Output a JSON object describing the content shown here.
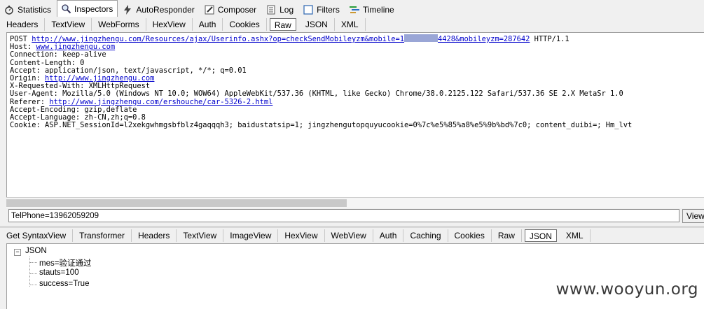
{
  "top_tabs": [
    {
      "label": "Statistics",
      "icon": "stopwatch-icon"
    },
    {
      "label": "Inspectors",
      "icon": "magnifier-icon",
      "active": true
    },
    {
      "label": "AutoResponder",
      "icon": "lightning-icon"
    },
    {
      "label": "Composer",
      "icon": "pencil-icon"
    },
    {
      "label": "Log",
      "icon": "log-icon"
    },
    {
      "label": "Filters",
      "icon": "checkbox-icon"
    },
    {
      "label": "Timeline",
      "icon": "timeline-icon"
    }
  ],
  "request_tabs": [
    "Headers",
    "TextView",
    "WebForms",
    "HexView",
    "Auth",
    "Cookies",
    "Raw",
    "JSON",
    "XML"
  ],
  "request_active": "Raw",
  "raw": {
    "method": "POST ",
    "url_pre": "http://www.jingzhengu.com/Resources/ajax/Userinfo.ashx?op=checkSendMobileyzm&mobile=1",
    "url_post": "4428&mobileyzm=287642",
    "protocol": " HTTP/1.1",
    "host_label": "Host: ",
    "host": "www.jingzhengu.com",
    "connection": "Connection: keep-alive",
    "content_length": "Content-Length: 0",
    "accept": "Accept: application/json, text/javascript, */*; q=0.01",
    "origin_label": "Origin: ",
    "origin": "http://www.jingzhengu.com",
    "x_requested": "X-Requested-With: XMLHttpRequest",
    "user_agent": "User-Agent: Mozilla/5.0 (Windows NT 10.0; WOW64) AppleWebKit/537.36 (KHTML, like Gecko) Chrome/38.0.2125.122 Safari/537.36 SE 2.X MetaSr 1.0",
    "referer_label": "Referer: ",
    "referer": "http://www.jingzhengu.com/ershouche/car-5326-2.html",
    "accept_encoding": "Accept-Encoding: gzip,deflate",
    "accept_language": "Accept-Language: zh-CN,zh;q=0.8",
    "cookie": "Cookie: ASP.NET_SessionId=l2xekgwhmgsbfblz4gaqqqh3; baidustatsip=1; jingzhengutopquyucookie=0%7c%e5%85%a8%e5%9b%bd%7c0; content_duibi=; Hm_lvt"
  },
  "body_input": "TelPhone=13962059209",
  "view_button": "View",
  "response_tabs": [
    "Get SyntaxView",
    "Transformer",
    "Headers",
    "TextView",
    "ImageView",
    "HexView",
    "WebView",
    "Auth",
    "Caching",
    "Cookies",
    "Raw",
    "JSON",
    "XML"
  ],
  "response_active": "JSON",
  "json_tree": {
    "root": "JSON",
    "expander": "−",
    "children": [
      "mes=验证通过",
      "stauts=100",
      "success=True"
    ]
  },
  "watermark": "www.wooyun.org"
}
